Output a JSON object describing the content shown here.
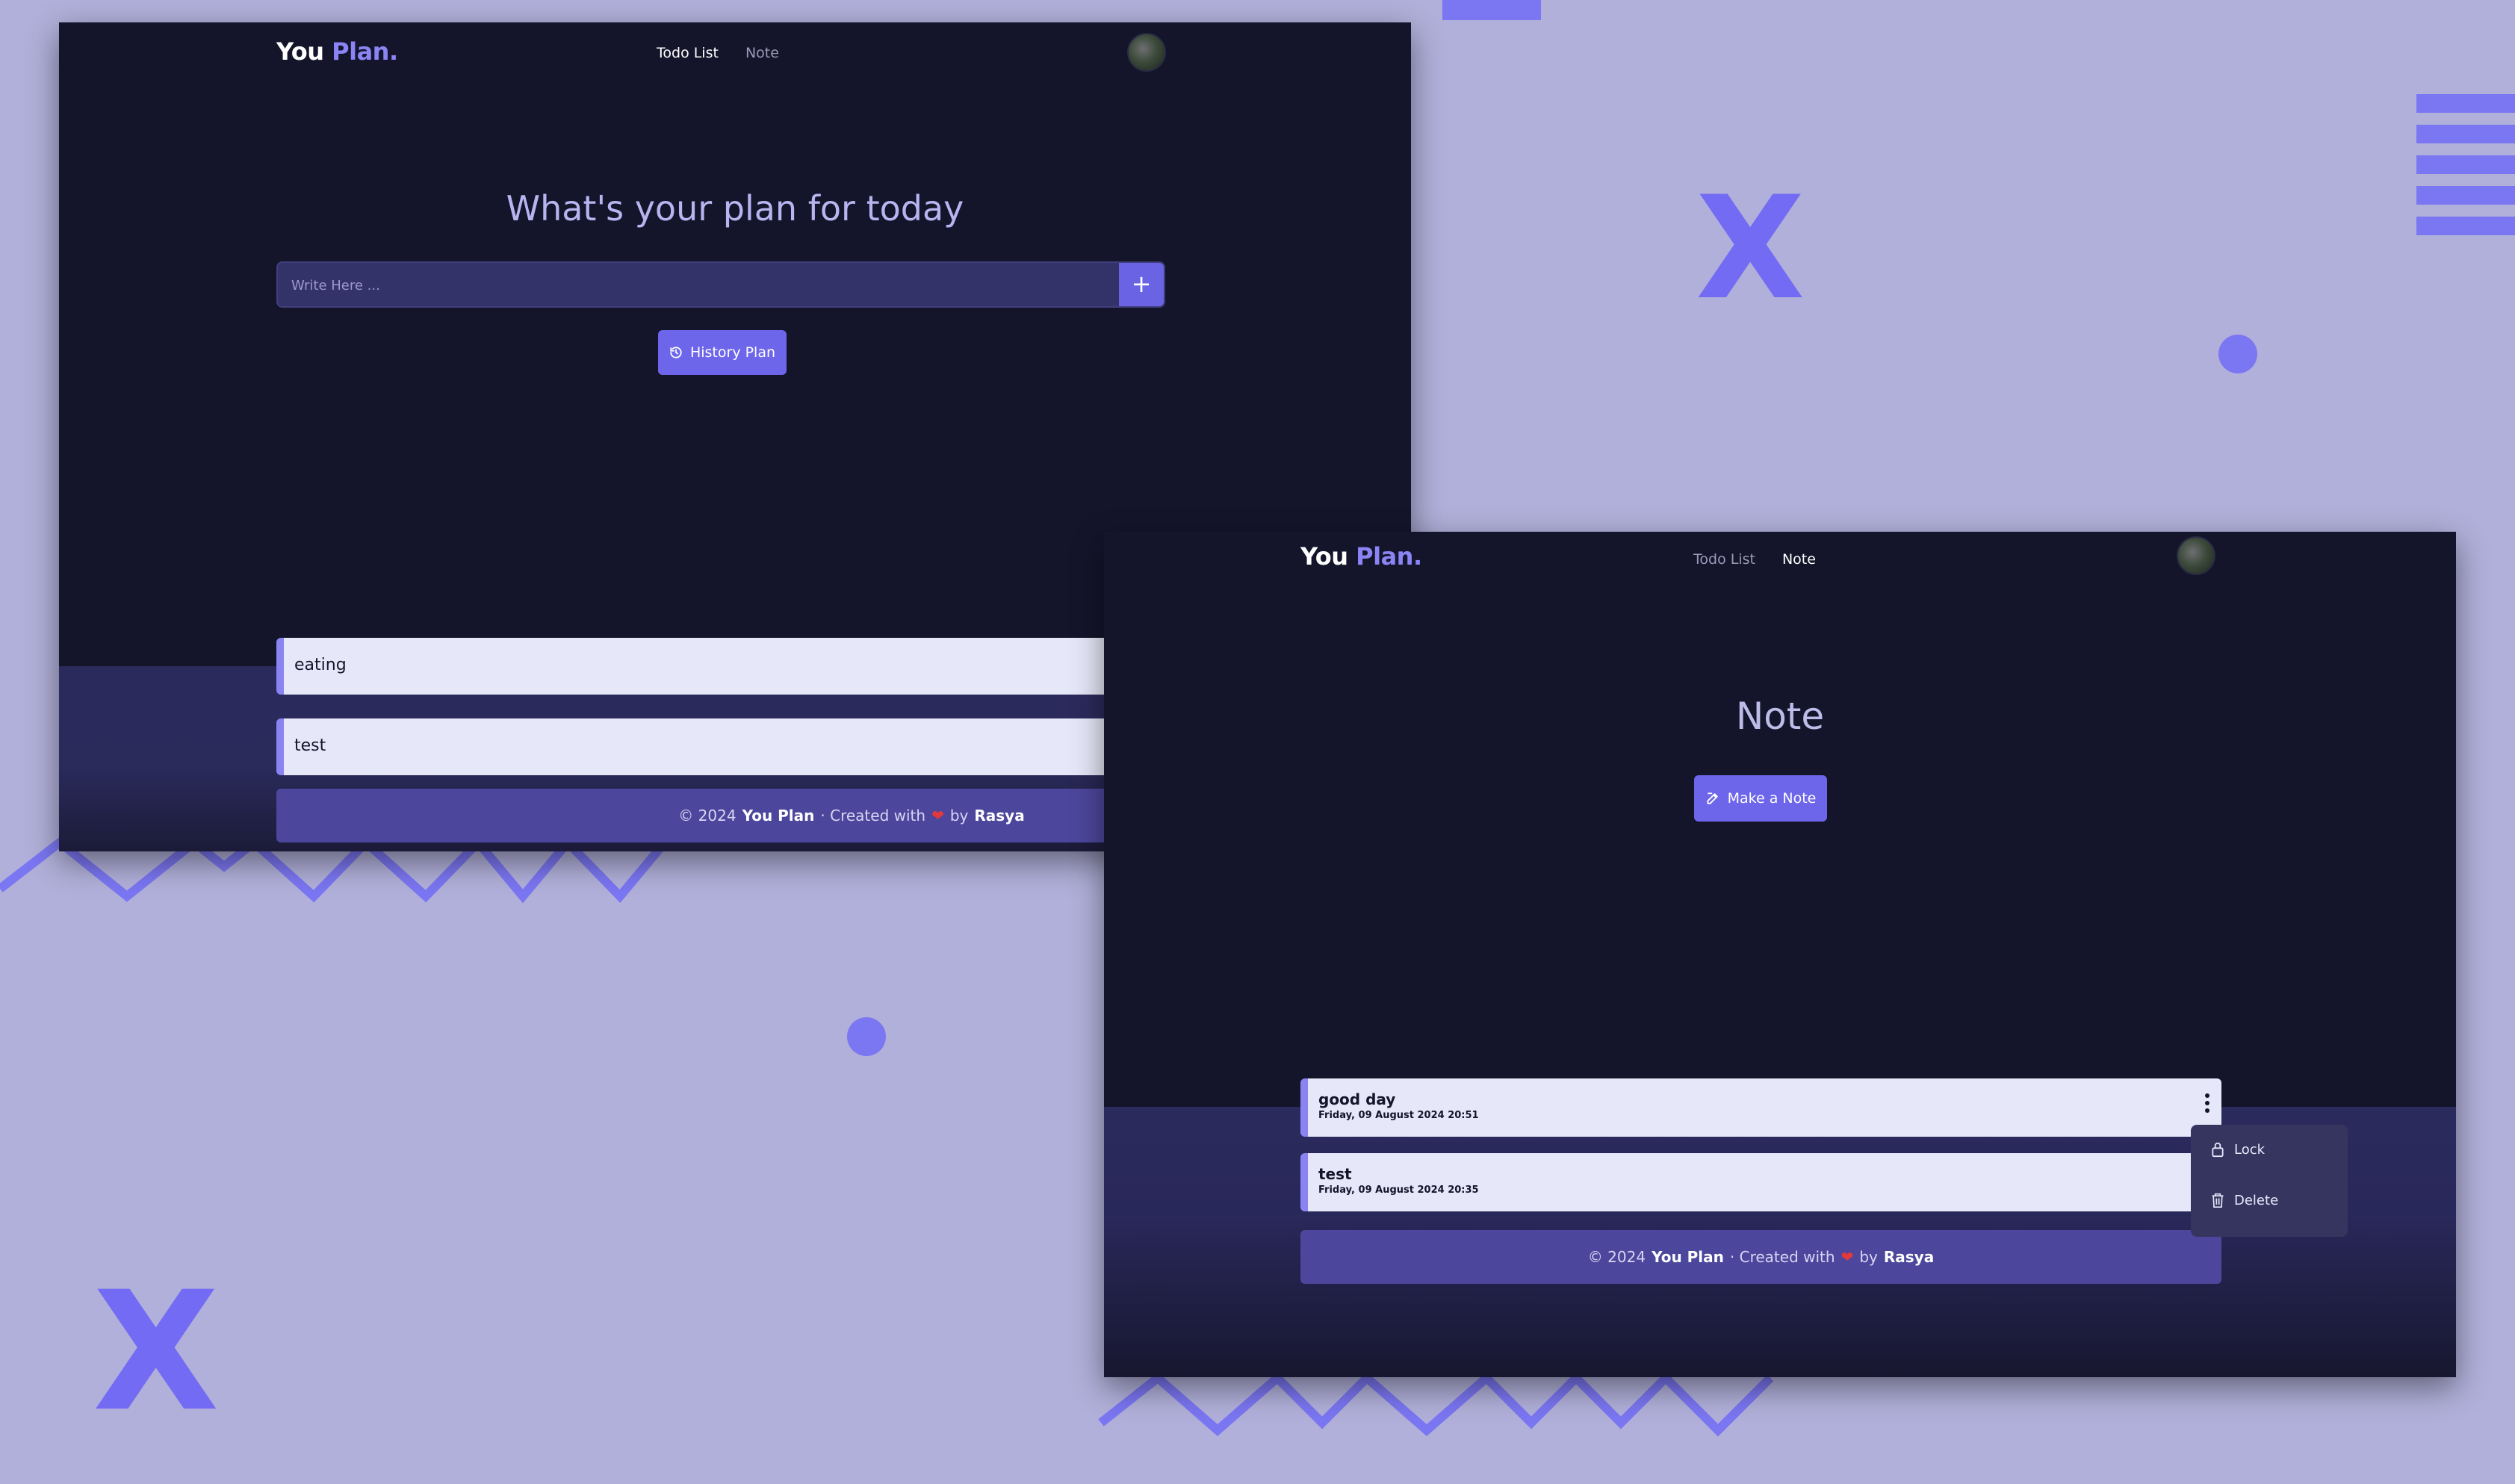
{
  "brand": {
    "you": "You",
    "plan": "Plan."
  },
  "nav": {
    "todo": "Todo List",
    "note": "Note"
  },
  "todo_page": {
    "title": "What's your plan for today",
    "input_placeholder": "Write Here ...",
    "add_symbol": "+",
    "history_button": "History Plan",
    "items": [
      {
        "text": "eating"
      },
      {
        "text": "test"
      }
    ]
  },
  "note_page": {
    "title": "Note",
    "make_button": "Make a Note",
    "notes": [
      {
        "title": "good day",
        "date": "Friday, 09 August 2024 20:51"
      },
      {
        "title": "test",
        "date": "Friday, 09 August 2024 20:35"
      }
    ],
    "menu": {
      "lock": "Lock",
      "delete": "Delete"
    }
  },
  "footer": {
    "copy": "© 2024",
    "name": "You Plan",
    "created": "· Created with",
    "heart": "❤",
    "by": "by",
    "author": "Rasya"
  },
  "colors": {
    "background": "#b1b0da",
    "accent": "#6e66ea",
    "window": "#14152b",
    "item": "#e6e7f8"
  }
}
